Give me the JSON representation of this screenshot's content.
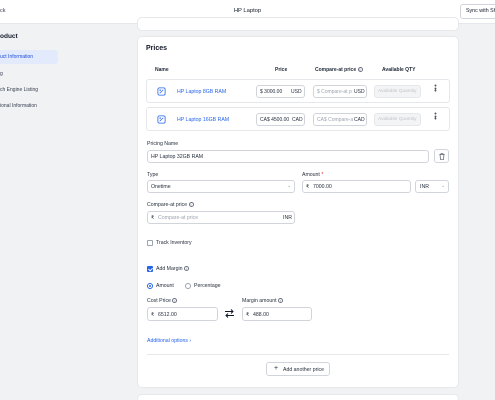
{
  "topbar": {
    "back_label": "ck",
    "title": "HP Laptop",
    "sync_label": "Sync with Sh"
  },
  "sidebar": {
    "heading": "oduct",
    "items": [
      {
        "label": "uct Information"
      },
      {
        "label": "g"
      },
      {
        "label": "ch Engine Listing"
      },
      {
        "label": "ional Information"
      }
    ]
  },
  "prices": {
    "title": "Prices",
    "columns": {
      "name": "Name",
      "price": "Price",
      "compare": "Compare-at price",
      "qty": "Available QTY"
    },
    "rows": [
      {
        "name": "HP Laptop 8GB RAM",
        "price": "$ 3000.00",
        "currency": "USD",
        "compare_placeholder": "$ Compare-at p",
        "compare_currency": "USD",
        "qty_placeholder": "Available Quantity"
      },
      {
        "name": "HP Laptop 16GB RAM",
        "price": "CA$ 4500.00",
        "currency": "CAD",
        "compare_placeholder": "CA$ Compare-a",
        "compare_currency": "CAD",
        "qty_placeholder": "Available Quantity"
      }
    ],
    "pricing_name_label": "Pricing Name",
    "pricing_name_value": "HP Laptop 32GB RAM",
    "type_label": "Type",
    "type_value": "Onetime",
    "amount_label": "Amount",
    "amount_required": "*",
    "amount_symbol": "₹",
    "amount_value": "7000.00",
    "amount_currency": "INR",
    "compare_label": "Compare-at price",
    "compare_symbol": "₹",
    "compare_placeholder": "Compare-at price",
    "compare_currency": "INR",
    "track_inventory_label": "Track Inventory",
    "add_margin_label": "Add Margin",
    "radio_amount_label": "Amount",
    "radio_percentage_label": "Percentage",
    "cost_price_label": "Cost Price",
    "cost_price_symbol": "₹",
    "cost_price_value": "6512.00",
    "margin_amount_label": "Margin amount",
    "margin_amount_symbol": "₹",
    "margin_amount_value": "488.00",
    "additional_options_label": "Additional options",
    "additional_options_chevron": "›",
    "add_price_label": "Add another price",
    "add_price_plus": "+"
  },
  "colors": {
    "accent": "#2563eb",
    "border": "#d1d5db",
    "bg": "#f1f2f4"
  }
}
